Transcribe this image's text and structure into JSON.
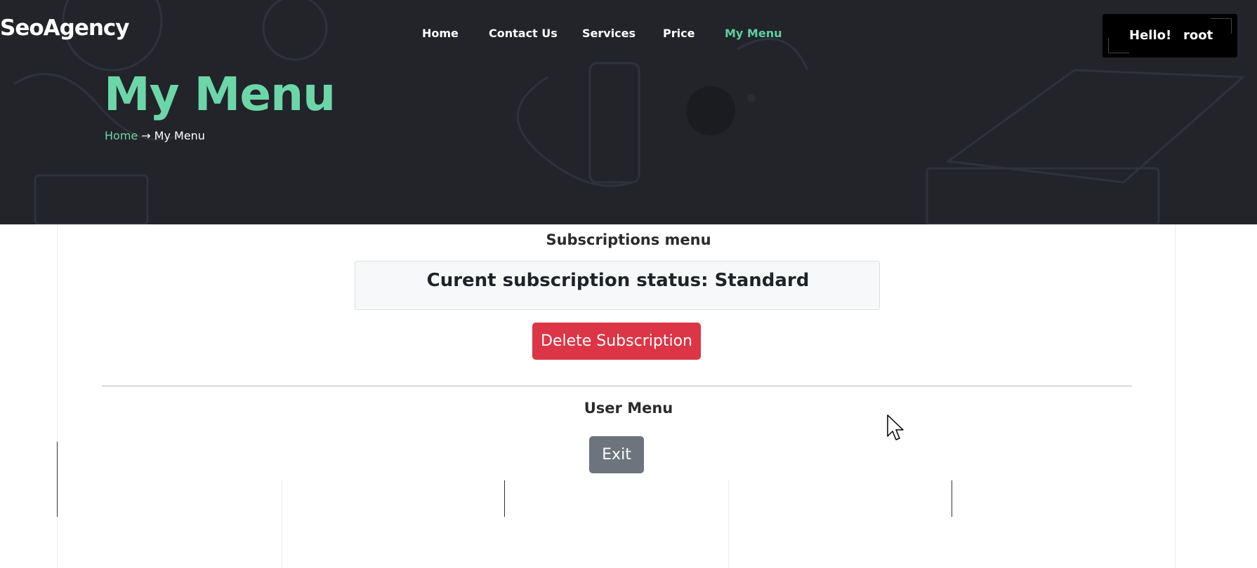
{
  "header": {
    "logo": "SeoAgency",
    "nav": [
      {
        "label": "Home",
        "active": false
      },
      {
        "label": "Contact Us",
        "active": false
      },
      {
        "label": "Services",
        "active": false
      },
      {
        "label": "Price",
        "active": false
      },
      {
        "label": "My Menu",
        "active": true
      }
    ],
    "greeting": "Hello!",
    "username": "root"
  },
  "hero": {
    "title": "My Menu",
    "breadcrumb": {
      "home": "Home",
      "separator": "→",
      "current": "My Menu"
    }
  },
  "subscriptions": {
    "heading": "Subscriptions menu",
    "status_text": "Curent subscription status: Standard",
    "delete_label": "Delete Subscription"
  },
  "user_menu": {
    "heading": "User Menu",
    "exit_label": "Exit"
  },
  "colors": {
    "accent": "#6dd6a9",
    "hero_bg": "#22242a",
    "danger": "#dc3545",
    "secondary": "#6c757d"
  }
}
